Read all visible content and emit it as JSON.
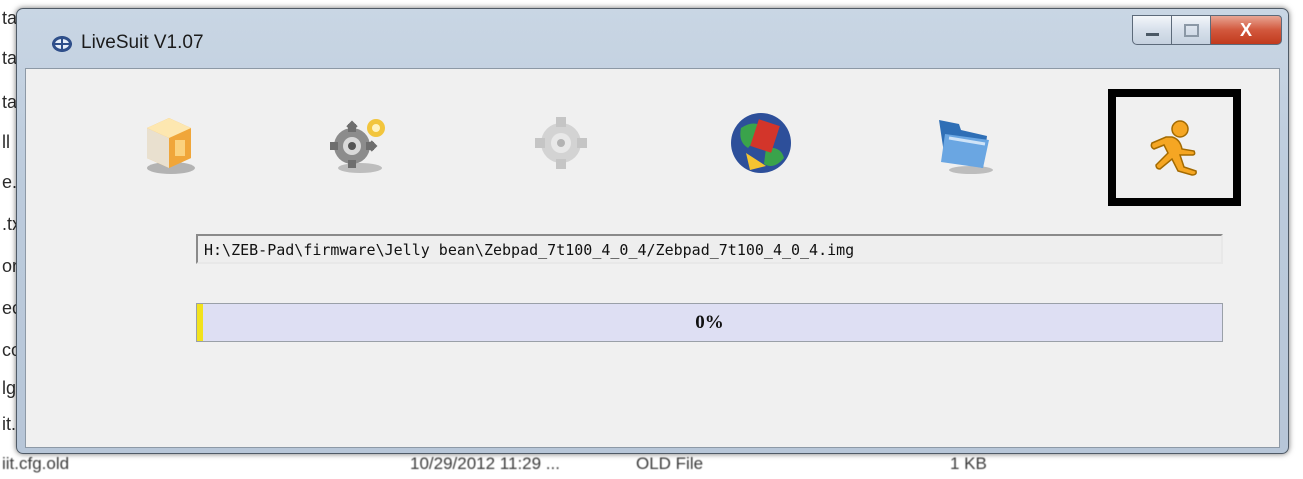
{
  "background": {
    "left_fragments": [
      "tal",
      "tal",
      "tal",
      "ll",
      "e.a",
      ".tx",
      "ory",
      "eco",
      "cor",
      "lg",
      "it."
    ],
    "bottom_row": {
      "name": "iit.cfg.old",
      "date": "10/29/2012 11:29 ...",
      "type": "OLD File",
      "size": "1 KB"
    }
  },
  "window": {
    "title": "LiveSuit V1.07",
    "controls": {
      "minimize": "minimize",
      "maximize": "maximize",
      "close": "X"
    }
  },
  "toolbar": {
    "buttons": [
      {
        "icon": "package-box-icon"
      },
      {
        "icon": "gear-settings-icon"
      },
      {
        "icon": "gear-disabled-icon"
      },
      {
        "icon": "globe-network-icon"
      },
      {
        "icon": "folder-open-icon"
      },
      {
        "icon": "running-man-icon",
        "selected": true
      }
    ]
  },
  "image_path": "H:\\ZEB-Pad\\firmware\\Jelly bean\\Zebpad_7t100_4_0_4/Zebpad_7t100_4_0_4.img",
  "progress": {
    "value": 0,
    "label": "0%"
  },
  "colors": {
    "progress_bg": "#dedff3",
    "progress_fill": "#f2e21d",
    "close_button": "#c13a1d"
  }
}
